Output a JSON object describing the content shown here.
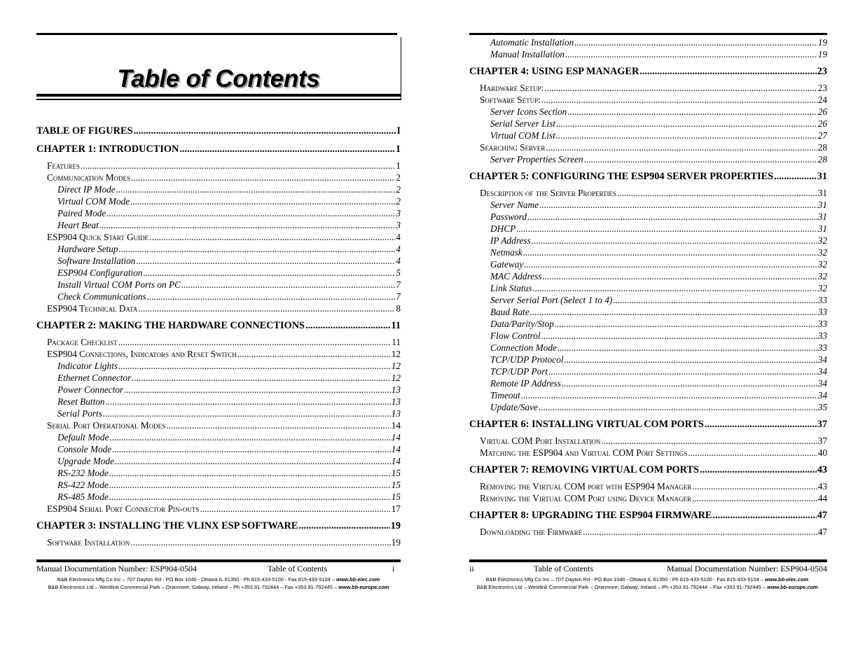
{
  "left_page": {
    "title": "Table of Contents",
    "entries": [
      {
        "level": 1,
        "label": "TABLE OF FIGURES",
        "page": "I"
      },
      {
        "level": 1,
        "label": "CHAPTER 1: INTRODUCTION",
        "page": "1"
      },
      {
        "level": 2,
        "label": "Features",
        "page": "1"
      },
      {
        "level": 2,
        "label": "Communication Modes",
        "page": "2"
      },
      {
        "level": 3,
        "label": "Direct IP Mode",
        "page": "2"
      },
      {
        "level": 3,
        "label": "Virtual COM Mode",
        "page": "2"
      },
      {
        "level": 3,
        "label": "Paired Mode",
        "page": "3"
      },
      {
        "level": 3,
        "label": "Heart Beat",
        "page": "3"
      },
      {
        "level": 2,
        "label": "ESP904 Quick Start Guide",
        "page": "4"
      },
      {
        "level": 3,
        "label": "Hardware Setup",
        "page": "4"
      },
      {
        "level": 3,
        "label": "Software Installation",
        "page": "4"
      },
      {
        "level": 3,
        "label": "ESP904 Configuration",
        "page": "5"
      },
      {
        "level": 3,
        "label": "Install Virtual COM Ports on PC",
        "page": "7"
      },
      {
        "level": 3,
        "label": "Check Communications",
        "page": "7"
      },
      {
        "level": 2,
        "label": "ESP904 Technical Data",
        "page": "8"
      },
      {
        "level": 1,
        "label": "CHAPTER 2: MAKING THE HARDWARE CONNECTIONS",
        "page": "11"
      },
      {
        "level": 2,
        "label": "Package Checklist",
        "page": "11"
      },
      {
        "level": 2,
        "label": "ESP904 Connections, Indicators and Reset Switch",
        "page": "12"
      },
      {
        "level": 3,
        "label": "Indicator Lights",
        "page": "12"
      },
      {
        "level": 3,
        "label": "Ethernet Connector",
        "page": "12"
      },
      {
        "level": 3,
        "label": "Power Connector",
        "page": "13"
      },
      {
        "level": 3,
        "label": "Reset Button",
        "page": "13"
      },
      {
        "level": 3,
        "label": "Serial Ports",
        "page": "13"
      },
      {
        "level": 2,
        "label": "Serial Port Operational Modes",
        "page": "14"
      },
      {
        "level": 3,
        "label": "Default Mode",
        "page": "14"
      },
      {
        "level": 3,
        "label": "Console Mode",
        "page": "14"
      },
      {
        "level": 3,
        "label": "Upgrade Mode",
        "page": "14"
      },
      {
        "level": 3,
        "label": "RS-232 Mode",
        "page": "15"
      },
      {
        "level": 3,
        "label": "RS-422 Mode",
        "page": "15"
      },
      {
        "level": 3,
        "label": "RS-485 Mode",
        "page": "15"
      },
      {
        "level": 2,
        "label": "ESP904 Serial Port Connector Pin-outs",
        "page": "17"
      },
      {
        "level": 1,
        "label": "CHAPTER 3: INSTALLING THE VLINX ESP SOFTWARE",
        "page": "19"
      },
      {
        "level": 2,
        "label": "Software Installation",
        "page": "19"
      }
    ],
    "footer": {
      "doc_number": "Manual Documentation Number: ESP904-0504",
      "section": "Table of Contents",
      "page_number": "i"
    }
  },
  "right_page": {
    "entries": [
      {
        "level": 3,
        "label": "Automatic Installation",
        "page": "19"
      },
      {
        "level": 3,
        "label": "Manual Installation",
        "page": "19"
      },
      {
        "level": 1,
        "label": "CHAPTER 4: USING ESP MANAGER",
        "page": "23"
      },
      {
        "level": 2,
        "label": "Hardware Setup:",
        "page": "23"
      },
      {
        "level": 2,
        "label": "Software Setup:",
        "page": "24"
      },
      {
        "level": 3,
        "label": "Server Icons Section",
        "page": "26"
      },
      {
        "level": 3,
        "label": "Serial Server List",
        "page": "26"
      },
      {
        "level": 3,
        "label": "Virtual COM List",
        "page": "27"
      },
      {
        "level": 2,
        "label": "Searching Server",
        "page": "28"
      },
      {
        "level": 3,
        "label": "Server Properties Screen",
        "page": "28"
      },
      {
        "level": 1,
        "label": "CHAPTER 5: CONFIGURING THE ESP904 SERVER PROPERTIES",
        "page": "31"
      },
      {
        "level": 2,
        "label": "Description of the Server Properties",
        "page": "31"
      },
      {
        "level": 3,
        "label": "Server Name",
        "page": "31"
      },
      {
        "level": 3,
        "label": "Password",
        "page": "31"
      },
      {
        "level": 3,
        "label": "DHCP",
        "page": "31"
      },
      {
        "level": 3,
        "label": "IP Address",
        "page": "32"
      },
      {
        "level": 3,
        "label": "Netmask",
        "page": "32"
      },
      {
        "level": 3,
        "label": "Gateway",
        "page": "32"
      },
      {
        "level": 3,
        "label": "MAC Address",
        "page": "32"
      },
      {
        "level": 3,
        "label": "Link Status",
        "page": "32"
      },
      {
        "level": 3,
        "label": "Server Serial Port (Select 1 to 4)",
        "page": "33"
      },
      {
        "level": 3,
        "label": "Baud Rate",
        "page": "33"
      },
      {
        "level": 3,
        "label": "Data/Parity/Stop",
        "page": "33"
      },
      {
        "level": 3,
        "label": "Flow Control",
        "page": "33"
      },
      {
        "level": 3,
        "label": "Connection Mode",
        "page": "33"
      },
      {
        "level": 3,
        "label": "TCP/UDP Protocol",
        "page": "34"
      },
      {
        "level": 3,
        "label": "TCP/UDP Port",
        "page": "34"
      },
      {
        "level": 3,
        "label": "Remote IP Address",
        "page": "34"
      },
      {
        "level": 3,
        "label": "Timeout",
        "page": "34"
      },
      {
        "level": 3,
        "label": "Update/Save",
        "page": "35"
      },
      {
        "level": 1,
        "label": "CHAPTER 6: INSTALLING VIRTUAL COM PORTS",
        "page": "37"
      },
      {
        "level": 2,
        "label": "Virtual COM Port Installation",
        "page": "37"
      },
      {
        "level": 2,
        "label": "Matching the ESP904 and Virtual COM Port Settings",
        "page": "40"
      },
      {
        "level": 1,
        "label": "CHAPTER 7: REMOVING VIRTUAL COM PORTS",
        "page": "43"
      },
      {
        "level": 2,
        "label": "Removing the Virtual COM port with ESP904 Manager",
        "page": "43"
      },
      {
        "level": 2,
        "label": "Removing the Virtual COM Port using Device Manager",
        "page": "44"
      },
      {
        "level": 1,
        "label": "CHAPTER 8: UPGRADING THE ESP904 FIRMWARE",
        "page": "47"
      },
      {
        "level": 2,
        "label": "Downloading the Firmware",
        "page": "47"
      }
    ],
    "footer": {
      "page_number": "ii",
      "section": "Table of Contents",
      "doc_number": "Manual Documentation Number: ESP904-0504"
    }
  },
  "address": {
    "line1_text": "B&B Electronics Mfg Co Inc – 707 Dayton Rd - PO Box 1040 - Ottawa IL 61350 - Ph 815-433-5100 - Fax 815-433-5104 – ",
    "line1_url": "www.bb-elec.com",
    "line2_text": "B&B Electronics Ltd – Westlink Commercial Park – Oranmore, Galway, Ireland – Ph +353 91-792444 – Fax +353 91-792445 – ",
    "line2_url": "www.bb-europe.com"
  }
}
